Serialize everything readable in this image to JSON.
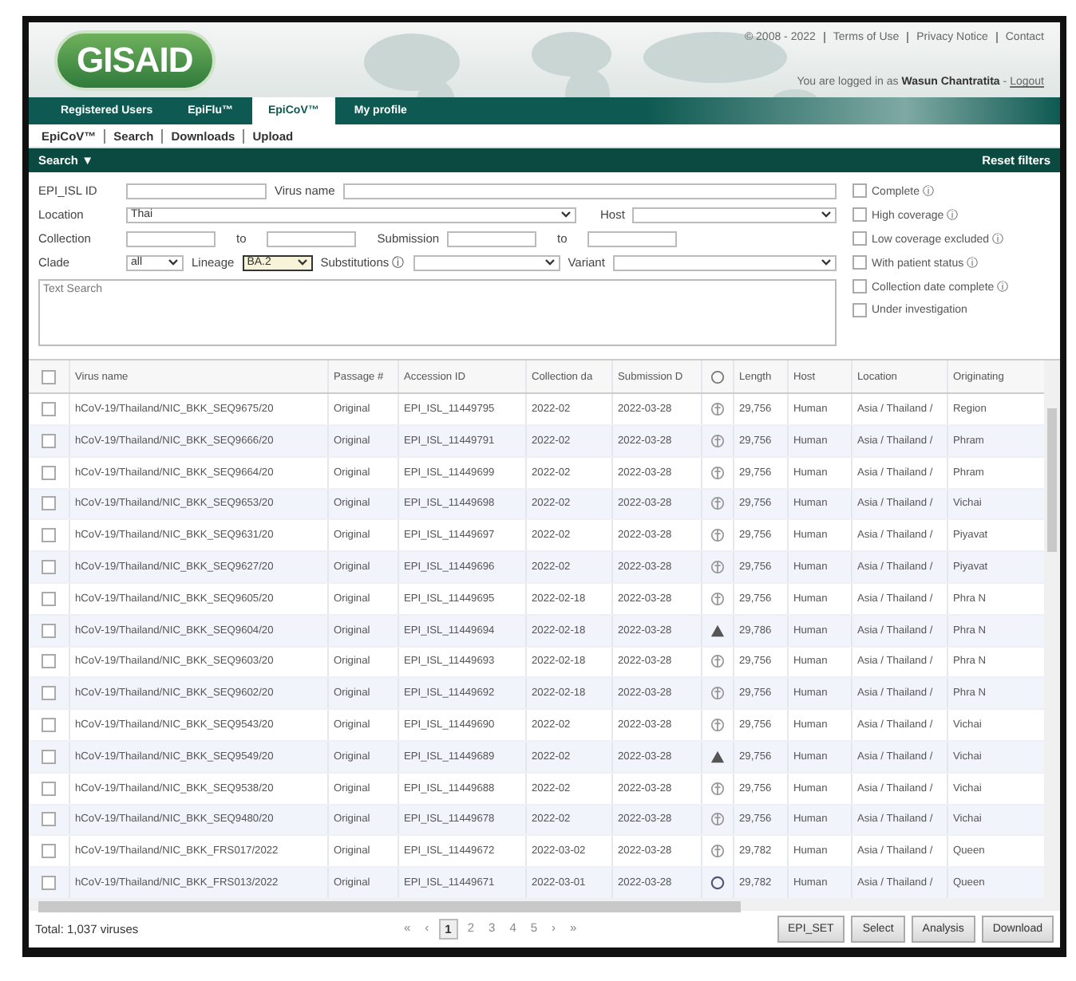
{
  "header": {
    "logo": "GISAID",
    "links": [
      "© 2008 - 2022",
      "Terms of Use",
      "Privacy Notice",
      "Contact"
    ],
    "login_text": "You are logged in as",
    "user": "Wasun Chantratita",
    "dash": "-",
    "logout": "Logout"
  },
  "tabs": [
    {
      "label": "Registered Users",
      "selected": false
    },
    {
      "label": "EpiFlu™",
      "selected": false
    },
    {
      "label": "EpiCoV™",
      "selected": true
    },
    {
      "label": "My profile",
      "selected": false
    }
  ],
  "subnav": [
    "EpiCoV™",
    "Search",
    "Downloads",
    "Upload"
  ],
  "search_bar": {
    "title": "Search ▼",
    "reset": "Reset filters"
  },
  "filters": {
    "epi_isl_label": "EPI_ISL ID",
    "virus_name_label": "Virus name",
    "location_label": "Location",
    "location_value": "Thai",
    "host_label": "Host",
    "collection_label": "Collection",
    "to_1": "to",
    "submission_label": "Submission",
    "to_2": "to",
    "clade_label": "Clade",
    "clade_value": "all",
    "lineage_label": "Lineage",
    "lineage_value": "BA.2",
    "lineage_focused": true,
    "substitutions_label": "Substitutions ⓘ",
    "variant_label": "Variant",
    "text_search_placeholder": "Text Search",
    "checkboxes": [
      {
        "label": "Complete ⓘ",
        "checked": false
      },
      {
        "label": "High coverage ⓘ",
        "checked": false
      },
      {
        "label": "Low coverage excluded ⓘ",
        "checked": false
      },
      {
        "label": "With patient status ⓘ",
        "checked": false
      },
      {
        "label": "Collection date complete ⓘ",
        "checked": false
      },
      {
        "label": "Under investigation",
        "checked": false
      }
    ]
  },
  "table": {
    "select_all_checked": false,
    "columns": [
      "Virus name",
      "Passage #",
      "Accession ID",
      "Collection da",
      "Submission D",
      "Length",
      "Host",
      "Location",
      "Originating"
    ],
    "rows": [
      {
        "kind": "info",
        "checked": false,
        "virus_name": "hCoV-19/Thailand/NIC_BKK_SEQ9675/20",
        "passage": "Original",
        "accession": "EPI_ISL_11449795",
        "collection": "2022-02",
        "submission": "2022-03-28",
        "length": "29,756",
        "host": "Human",
        "location": "Asia / Thailand /",
        "originating": "Region"
      },
      {
        "kind": "info",
        "checked": false,
        "virus_name": "hCoV-19/Thailand/NIC_BKK_SEQ9666/20",
        "passage": "Original",
        "accession": "EPI_ISL_11449791",
        "collection": "2022-02",
        "submission": "2022-03-28",
        "length": "29,756",
        "host": "Human",
        "location": "Asia / Thailand /",
        "originating": "Phram"
      },
      {
        "kind": "info",
        "checked": false,
        "virus_name": "hCoV-19/Thailand/NIC_BKK_SEQ9664/20",
        "passage": "Original",
        "accession": "EPI_ISL_11449699",
        "collection": "2022-02",
        "submission": "2022-03-28",
        "length": "29,756",
        "host": "Human",
        "location": "Asia / Thailand /",
        "originating": "Phram"
      },
      {
        "kind": "info",
        "checked": false,
        "virus_name": "hCoV-19/Thailand/NIC_BKK_SEQ9653/20",
        "passage": "Original",
        "accession": "EPI_ISL_11449698",
        "collection": "2022-02",
        "submission": "2022-03-28",
        "length": "29,756",
        "host": "Human",
        "location": "Asia / Thailand /",
        "originating": "Vichai"
      },
      {
        "kind": "info",
        "checked": false,
        "virus_name": "hCoV-19/Thailand/NIC_BKK_SEQ9631/20",
        "passage": "Original",
        "accession": "EPI_ISL_11449697",
        "collection": "2022-02",
        "submission": "2022-03-28",
        "length": "29,756",
        "host": "Human",
        "location": "Asia / Thailand /",
        "originating": "Piyavat"
      },
      {
        "kind": "info",
        "checked": false,
        "virus_name": "hCoV-19/Thailand/NIC_BKK_SEQ9627/20",
        "passage": "Original",
        "accession": "EPI_ISL_11449696",
        "collection": "2022-02",
        "submission": "2022-03-28",
        "length": "29,756",
        "host": "Human",
        "location": "Asia / Thailand /",
        "originating": "Piyavat"
      },
      {
        "kind": "info",
        "checked": false,
        "virus_name": "hCoV-19/Thailand/NIC_BKK_SEQ9605/20",
        "passage": "Original",
        "accession": "EPI_ISL_11449695",
        "collection": "2022-02-18",
        "submission": "2022-03-28",
        "length": "29,756",
        "host": "Human",
        "location": "Asia / Thailand /",
        "originating": "Phra N"
      },
      {
        "kind": "warning",
        "checked": false,
        "virus_name": "hCoV-19/Thailand/NIC_BKK_SEQ9604/20",
        "passage": "Original",
        "accession": "EPI_ISL_11449694",
        "collection": "2022-02-18",
        "submission": "2022-03-28",
        "length": "29,786",
        "host": "Human",
        "location": "Asia / Thailand /",
        "originating": "Phra N"
      },
      {
        "kind": "info",
        "checked": false,
        "virus_name": "hCoV-19/Thailand/NIC_BKK_SEQ9603/20",
        "passage": "Original",
        "accession": "EPI_ISL_11449693",
        "collection": "2022-02-18",
        "submission": "2022-03-28",
        "length": "29,756",
        "host": "Human",
        "location": "Asia / Thailand /",
        "originating": "Phra N"
      },
      {
        "kind": "info",
        "checked": false,
        "virus_name": "hCoV-19/Thailand/NIC_BKK_SEQ9602/20",
        "passage": "Original",
        "accession": "EPI_ISL_11449692",
        "collection": "2022-02-18",
        "submission": "2022-03-28",
        "length": "29,756",
        "host": "Human",
        "location": "Asia / Thailand /",
        "originating": "Phra N"
      },
      {
        "kind": "info",
        "checked": false,
        "virus_name": "hCoV-19/Thailand/NIC_BKK_SEQ9543/20",
        "passage": "Original",
        "accession": "EPI_ISL_11449690",
        "collection": "2022-02",
        "submission": "2022-03-28",
        "length": "29,756",
        "host": "Human",
        "location": "Asia / Thailand /",
        "originating": "Vichai"
      },
      {
        "kind": "warning",
        "checked": false,
        "virus_name": "hCoV-19/Thailand/NIC_BKK_SEQ9549/20",
        "passage": "Original",
        "accession": "EPI_ISL_11449689",
        "collection": "2022-02",
        "submission": "2022-03-28",
        "length": "29,756",
        "host": "Human",
        "location": "Asia / Thailand /",
        "originating": "Vichai"
      },
      {
        "kind": "info",
        "checked": false,
        "virus_name": "hCoV-19/Thailand/NIC_BKK_SEQ9538/20",
        "passage": "Original",
        "accession": "EPI_ISL_11449688",
        "collection": "2022-02",
        "submission": "2022-03-28",
        "length": "29,756",
        "host": "Human",
        "location": "Asia / Thailand /",
        "originating": "Vichai"
      },
      {
        "kind": "info",
        "checked": false,
        "virus_name": "hCoV-19/Thailand/NIC_BKK_SEQ9480/20",
        "passage": "Original",
        "accession": "EPI_ISL_11449678",
        "collection": "2022-02",
        "submission": "2022-03-28",
        "length": "29,756",
        "host": "Human",
        "location": "Asia / Thailand /",
        "originating": "Vichai"
      },
      {
        "kind": "info",
        "checked": false,
        "virus_name": "hCoV-19/Thailand/NIC_BKK_FRS017/2022",
        "passage": "Original",
        "accession": "EPI_ISL_11449672",
        "collection": "2022-03-02",
        "submission": "2022-03-28",
        "length": "29,782",
        "host": "Human",
        "location": "Asia / Thailand /",
        "originating": "Queen"
      },
      {
        "kind": "circle",
        "checked": false,
        "virus_name": "hCoV-19/Thailand/NIC_BKK_FRS013/2022",
        "passage": "Original",
        "accession": "EPI_ISL_11449671",
        "collection": "2022-03-01",
        "submission": "2022-03-28",
        "length": "29,782",
        "host": "Human",
        "location": "Asia / Thailand /",
        "originating": "Queen"
      }
    ]
  },
  "footer": {
    "total": "Total: 1,037 viruses",
    "pages": [
      {
        "label": "«",
        "selected": false
      },
      {
        "label": "‹",
        "selected": false
      },
      {
        "label": "1",
        "selected": true
      },
      {
        "label": "2",
        "selected": false
      },
      {
        "label": "3",
        "selected": false
      },
      {
        "label": "4",
        "selected": false
      },
      {
        "label": "5",
        "selected": false
      },
      {
        "label": "›",
        "selected": false
      },
      {
        "label": "»",
        "selected": false
      }
    ],
    "buttons": [
      "EPI_SET",
      "Select",
      "Analysis",
      "Download"
    ]
  }
}
